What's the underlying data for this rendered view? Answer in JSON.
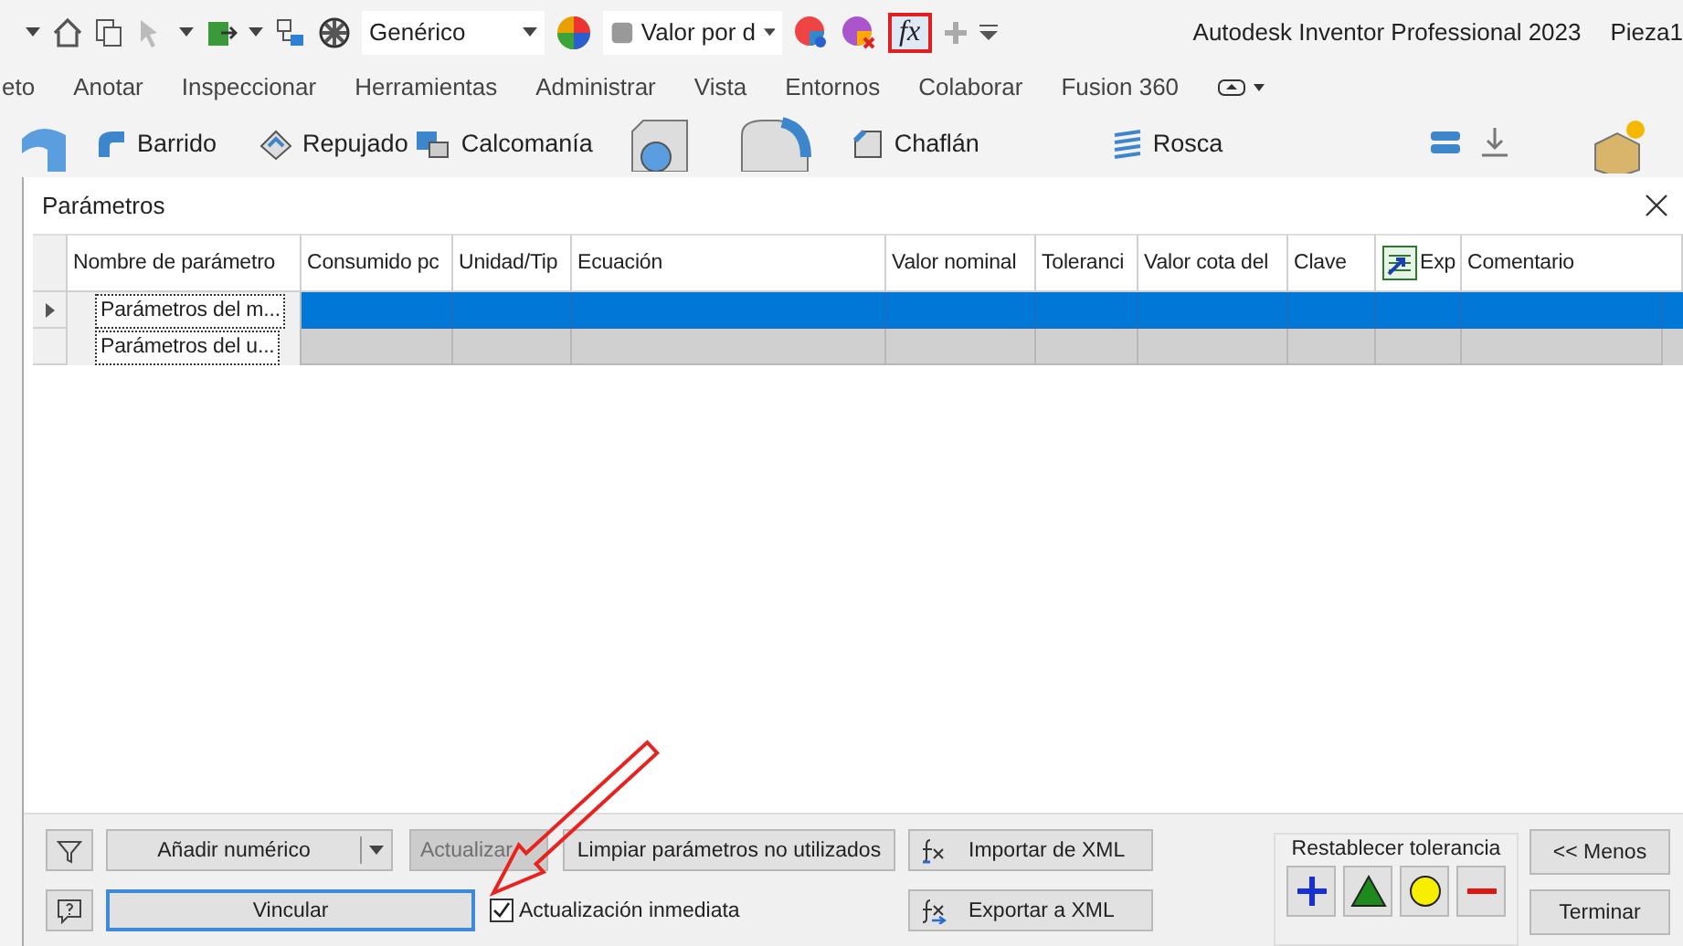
{
  "quick_access": {
    "material": "Genérico",
    "appearance": "Valor por d",
    "formula": {
      "label": "fx",
      "highlighted": true
    }
  },
  "app_title": "Autodesk Inventor Professional 2023",
  "document": "Pieza1",
  "ribbon_tabs": [
    "eto",
    "Anotar",
    "Inspeccionar",
    "Herramientas",
    "Administrar",
    "Vista",
    "Entornos",
    "Colaborar",
    "Fusion 360"
  ],
  "ribbon_tools": [
    {
      "kind": "sweep",
      "label": "Barrido"
    },
    {
      "kind": "emboss",
      "label": "Repujado"
    },
    {
      "kind": "decal",
      "label": "Calcomanía"
    },
    {
      "kind": "chamfer",
      "label": "Chaflán"
    },
    {
      "kind": "thread",
      "label": "Rosca"
    }
  ],
  "dialog": {
    "title": "Parámetros",
    "columns": [
      "Nombre de parámetro",
      "Consumido pc",
      "Unidad/Tip",
      "Ecuación",
      "Valor nominal",
      "Toleranci",
      "Valor cota del",
      "Clave",
      "Exp",
      "Comentario"
    ],
    "rows": [
      {
        "name": "Parámetros del m...",
        "selected": true
      },
      {
        "name": "Parámetros del u...",
        "selected": false
      }
    ],
    "add_button": "Añadir numérico",
    "update_button": {
      "label": "Actualizar",
      "disabled": true
    },
    "purge_button": "Limpiar parámetros no utilizados",
    "import_button": "Importar de XML",
    "export_button": "Exportar a XML",
    "link_button": "Vincular",
    "immediate_update": {
      "label": "Actualización inmediata",
      "checked": true
    },
    "tolerance": {
      "title": "Restablecer tolerancia",
      "buttons": [
        {
          "kind": "upper"
        },
        {
          "kind": "median"
        },
        {
          "kind": "nominal"
        },
        {
          "kind": "lower"
        }
      ]
    },
    "less_button": "<< Menos",
    "done_button": "Terminar"
  }
}
